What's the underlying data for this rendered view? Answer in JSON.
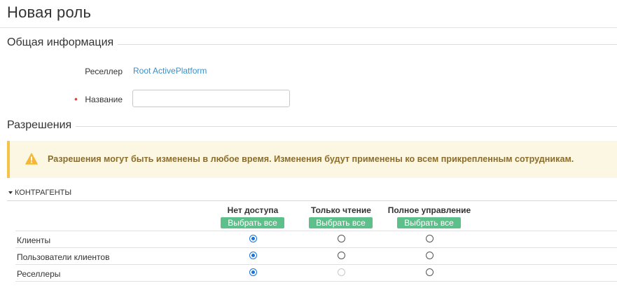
{
  "page": {
    "title": "Новая роль"
  },
  "general": {
    "heading": "Общая информация",
    "reseller_label": "Реселлер",
    "reseller_value": "Root ActivePlatform",
    "name_label": "Название",
    "name_value": "",
    "required_mark": "•"
  },
  "permissions": {
    "heading": "Разрешения",
    "warning": "Разрешения могут быть изменены в любое время. Изменения будут применены ко всем прикрепленным сотрудникам.",
    "group": {
      "title": "КОНТРАГЕНТЫ",
      "columns": [
        {
          "label": "Нет доступа",
          "select_all": "Выбрать все"
        },
        {
          "label": "Только чтение",
          "select_all": "Выбрать все"
        },
        {
          "label": "Полное управление",
          "select_all": "Выбрать все"
        }
      ],
      "rows": [
        {
          "label": "Клиенты",
          "selected": "Нет доступа",
          "disabled": []
        },
        {
          "label": "Пользователи клиентов",
          "selected": "Нет доступа",
          "disabled": []
        },
        {
          "label": "Реселлеры",
          "selected": "Нет доступа",
          "disabled": [
            "Только чтение"
          ]
        }
      ]
    }
  },
  "colors": {
    "accent_link": "#3a8fc9",
    "select_all_bg": "#5dbf8a",
    "warning_border": "#f6c34a",
    "warning_bg": "#fcf7e3",
    "warning_text": "#8a6d2b",
    "required": "#e0483c"
  }
}
